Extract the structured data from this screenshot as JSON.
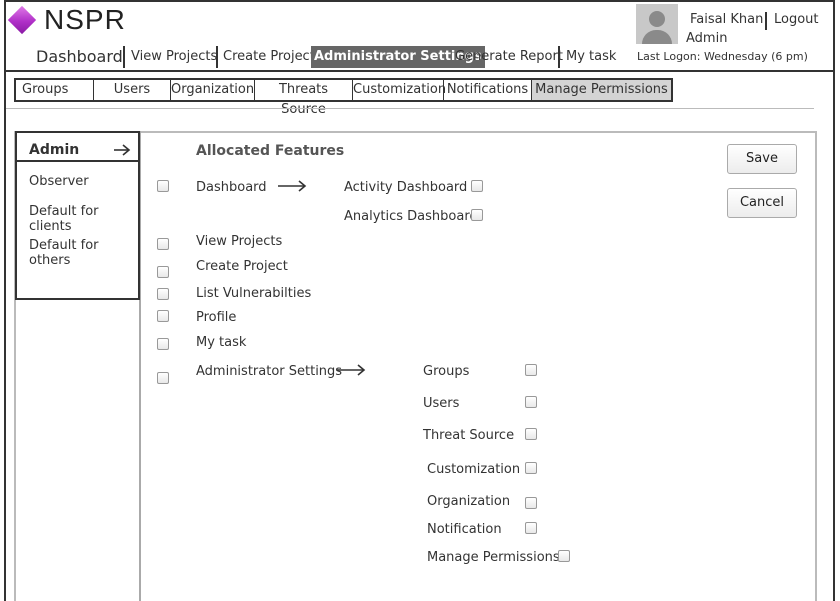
{
  "app": {
    "logo_text": "NSPR"
  },
  "user": {
    "name": "Faisal Khan",
    "logout_label": "Logout",
    "role": "Admin",
    "last_logon": "Last Logon:  Wednesday (6 pm)"
  },
  "nav": {
    "items": [
      {
        "label": "Dashboard"
      },
      {
        "label": "View Projects"
      },
      {
        "label": "Create Project"
      },
      {
        "label": "Administrator Settings",
        "active": true
      },
      {
        "label": "Generate Report"
      },
      {
        "label": "My task"
      }
    ]
  },
  "tabs": [
    {
      "label": "Groups"
    },
    {
      "label": "Users"
    },
    {
      "label": "Organization"
    },
    {
      "label": "Threats Source"
    },
    {
      "label": "Customization"
    },
    {
      "label": "Notifications"
    },
    {
      "label": "Manage Permissions",
      "active": true
    }
  ],
  "roles": [
    {
      "label": "Admin",
      "selected": true
    },
    {
      "label": "Observer"
    },
    {
      "label": "Default for clients"
    },
    {
      "label": "Default for others"
    }
  ],
  "features": {
    "heading": "Allocated Features",
    "dashboard": {
      "label": "Dashboard",
      "sub": [
        "Activity Dashboard",
        "Analytics Dashboard"
      ]
    },
    "items": [
      "View Projects",
      "Create Project",
      "List Vulnerabilties",
      "Profile",
      "My task"
    ],
    "admin_settings": {
      "label": "Administrator Settings",
      "sub": [
        "Groups",
        "Users",
        "Threat Source",
        "Customization",
        "Organization",
        "Notification",
        "Manage Permissions"
      ]
    }
  },
  "actions": {
    "save_label": "Save",
    "cancel_label": "Cancel"
  },
  "colors": {
    "active_nav_bg": "#666666",
    "active_tab_bg": "#d4d4d4",
    "logo_accent": "#b030c8"
  },
  "icons": {
    "arrow": "right-arrow-icon",
    "avatar": "user-avatar-icon",
    "logo": "diamond-logo-icon"
  }
}
